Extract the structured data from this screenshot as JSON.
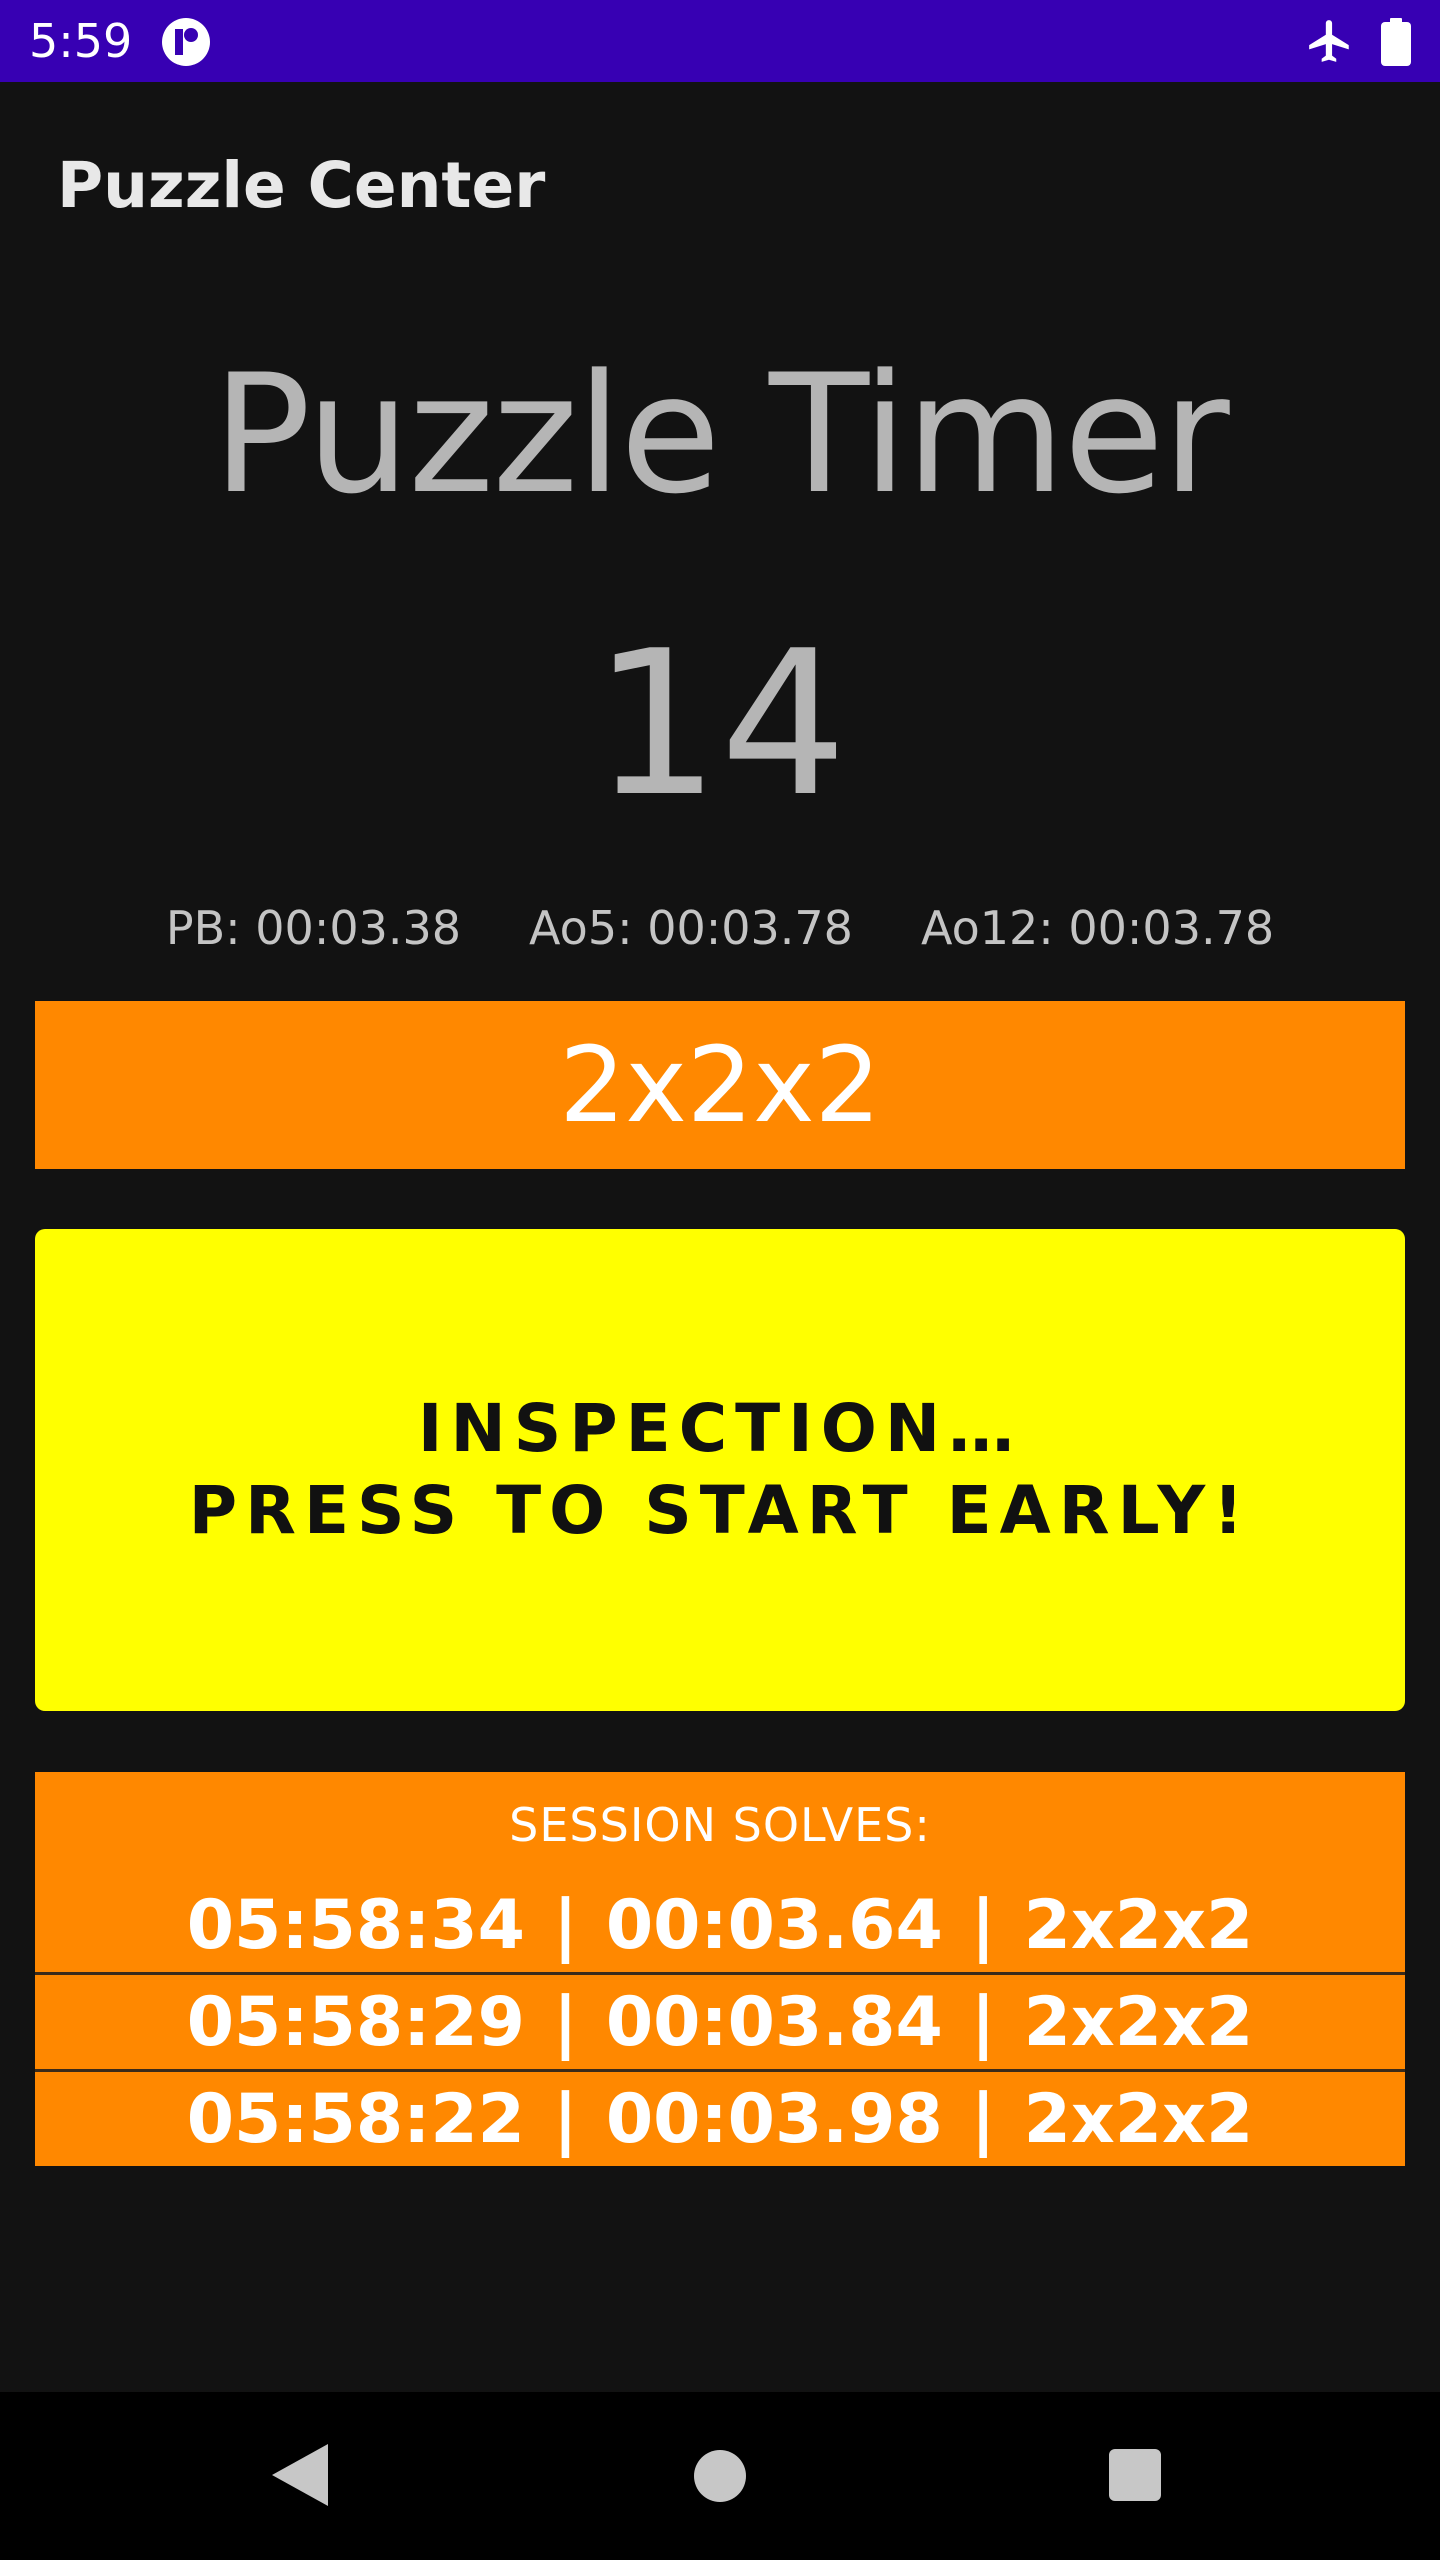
{
  "status_bar": {
    "time": "5:59",
    "icons": [
      "app-notification-icon",
      "airplane-mode-icon",
      "battery-icon"
    ]
  },
  "app_bar": {
    "title": "Puzzle Center"
  },
  "main": {
    "title": "Puzzle Timer",
    "countdown": "14",
    "stats": {
      "pb": "PB: 00:03.38",
      "ao5": "Ao5: 00:03.78",
      "ao12": "Ao12: 00:03.78"
    },
    "puzzle_type": "2x2x2",
    "timer_button": {
      "line1": "INSPECTION…",
      "line2": "PRESS TO START EARLY!"
    }
  },
  "session": {
    "header": "SESSION SOLVES:",
    "separator": "|",
    "solves": [
      {
        "time_of_day": "05:58:34",
        "duration": "00:03.64",
        "puzzle": "2x2x2"
      },
      {
        "time_of_day": "05:58:29",
        "duration": "00:03.84",
        "puzzle": "2x2x2"
      },
      {
        "time_of_day": "05:58:22",
        "duration": "00:03.98",
        "puzzle": "2x2x2"
      }
    ]
  },
  "colors": {
    "status_bar": "#3700b3",
    "background": "#121212",
    "accent_orange": "#ff8800",
    "timer_yellow": "#ffff00",
    "muted_text": "#b5b5b5"
  },
  "nav_bar": {
    "icons": [
      "back-icon",
      "home-icon",
      "recents-icon"
    ]
  }
}
